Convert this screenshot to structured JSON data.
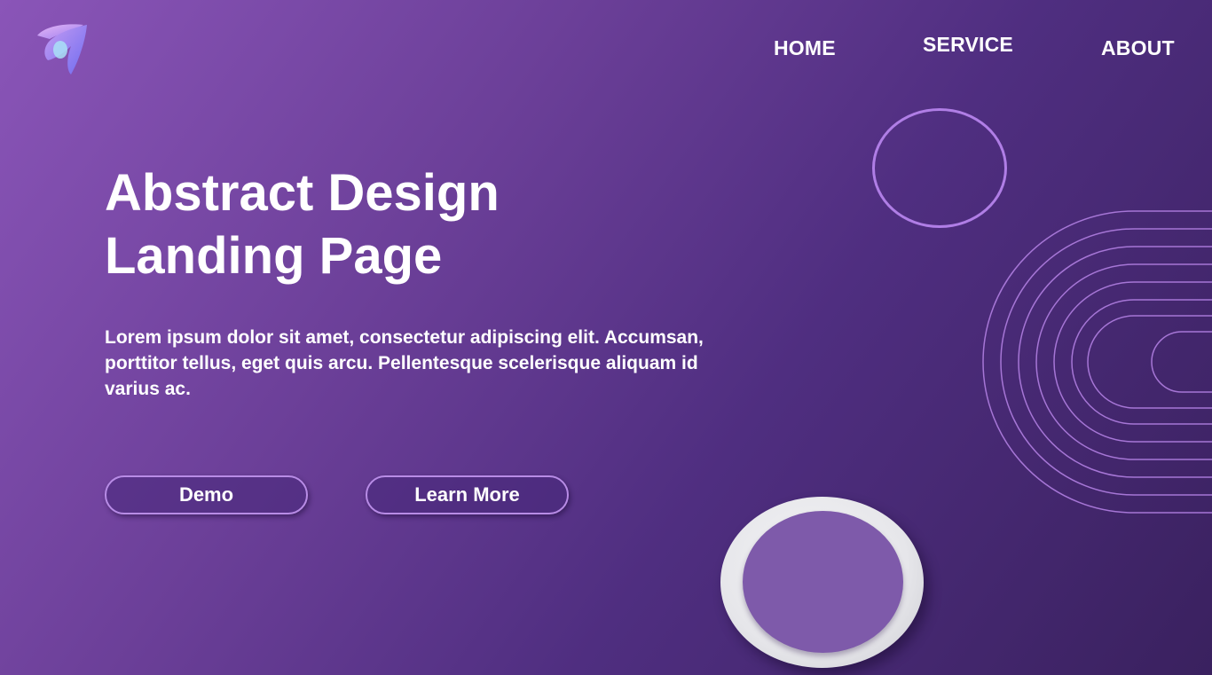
{
  "brand": {
    "logo_icon": "abstract-swirl-logo-icon"
  },
  "nav": {
    "items": [
      {
        "label": "HOME"
      },
      {
        "label": "SERVICE"
      },
      {
        "label": "ABOUT"
      }
    ]
  },
  "hero": {
    "title_line1": "Abstract Design",
    "title_line2": "Landing Page",
    "description": "Lorem ipsum dolor sit amet, consectetur adipiscing elit. Accumsan, porttitor tellus, eget quis arcu. Pellentesque scelerisque aliquam id varius ac.",
    "buttons": {
      "demo_label": "Demo",
      "learn_more_label": "Learn More"
    }
  },
  "colors": {
    "background_start": "#8a55b8",
    "background_end": "#3a215f",
    "accent": "#b07ee6",
    "text": "#ffffff"
  }
}
